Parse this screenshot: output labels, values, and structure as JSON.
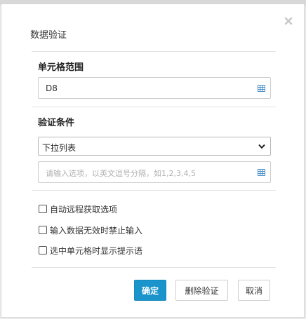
{
  "dialog": {
    "title": "数据验证",
    "close_icon": "close-icon"
  },
  "range_section": {
    "label": "单元格范围",
    "value": "D8",
    "icon": "grid-icon"
  },
  "condition_section": {
    "label": "验证条件",
    "selected_type": "下拉列表",
    "options_placeholder": "请输入选项，以英文逗号分隔，如1,2,3,4,5",
    "icon": "grid-icon"
  },
  "checkboxes": [
    {
      "label": "自动远程获取选项",
      "checked": false
    },
    {
      "label": "输入数据无效时禁止输入",
      "checked": false
    },
    {
      "label": "选中单元格时显示提示语",
      "checked": false
    }
  ],
  "buttons": {
    "confirm": "确定",
    "delete": "删除验证",
    "cancel": "取消"
  },
  "colors": {
    "primary": "#1a94cb",
    "icon_blue": "#4a90c8"
  }
}
